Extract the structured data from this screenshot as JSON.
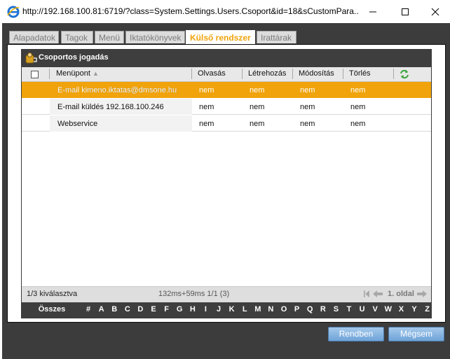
{
  "window": {
    "title": "http://192.168.100.81:6719/?class=System.Settings.Users.Csoport&id=18&sCustomPara...",
    "minimize_label": "—",
    "maximize_label": "☐",
    "close_label": "✕"
  },
  "tabs": [
    {
      "label": "Alapadatok",
      "active": false
    },
    {
      "label": "Tagok",
      "active": false
    },
    {
      "label": "Menü",
      "active": false
    },
    {
      "label": "Iktatókönyvek",
      "active": false
    },
    {
      "label": "Külső rendszer",
      "active": true
    },
    {
      "label": "Irattárak",
      "active": false
    }
  ],
  "grid": {
    "title": "Csoportos jogadás",
    "columns": {
      "menupont": "Menüpont",
      "sort_indicator": "▲",
      "olvasas": "Olvasás",
      "letrehozas": "Létrehozás",
      "modositas": "Módosítás",
      "torles": "Törlés"
    },
    "rows": [
      {
        "name": "E-mail kimeno.iktatas@dmsone.hu",
        "olvasas": "nem",
        "letrehozas": "nem",
        "modositas": "nem",
        "torles": "nem",
        "selected": true
      },
      {
        "name": "E-mail küldés 192.168.100.246",
        "olvasas": "nem",
        "letrehozas": "nem",
        "modositas": "nem",
        "torles": "nem",
        "selected": false
      },
      {
        "name": "Webservice",
        "olvasas": "nem",
        "letrehozas": "nem",
        "modositas": "nem",
        "torles": "nem",
        "selected": false
      }
    ],
    "footer": {
      "selection": "1/3 kiválasztva",
      "timing": "132ms+59ms 1/1 (3)",
      "page": "1. oldal"
    },
    "alphabet": {
      "all_label": "Összes",
      "letters": [
        "#",
        "A",
        "B",
        "C",
        "D",
        "E",
        "F",
        "G",
        "H",
        "I",
        "J",
        "K",
        "L",
        "M",
        "N",
        "O",
        "P",
        "Q",
        "R",
        "S",
        "T",
        "U",
        "V",
        "W",
        "X",
        "Y",
        "Z"
      ]
    }
  },
  "buttons": {
    "ok": "Rendben",
    "cancel": "Mégsem"
  },
  "colors": {
    "accent": "#f0a30a",
    "frame": "#3c3c3c",
    "button": "#7aaee0"
  },
  "icons": [
    "ie-icon",
    "group-rights-icon",
    "refresh-icon",
    "first-page-icon",
    "prev-page-icon",
    "next-page-icon"
  ]
}
